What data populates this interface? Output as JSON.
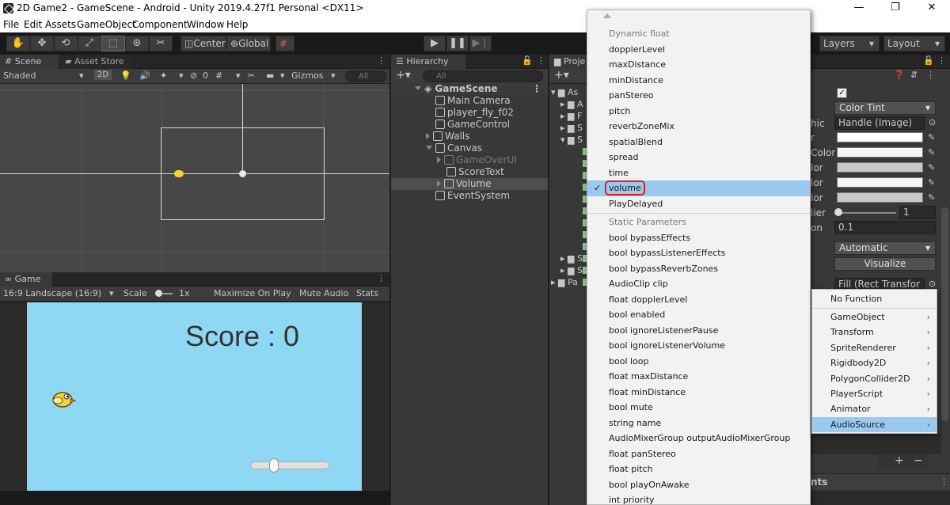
{
  "window": {
    "title": "2D Game2 - GameScene - Android - Unity 2019.4.27f1 Personal <DX11>"
  },
  "menubar": [
    "File",
    "Edit",
    "Assets",
    "GameObject",
    "Component",
    "Window",
    "Help"
  ],
  "toolbar": {
    "pivot": "Center",
    "space": "Global",
    "layers": "Layers",
    "layout": "Layout"
  },
  "scene": {
    "tabs": [
      "Scene",
      "Asset Store"
    ],
    "shading": "Shaded",
    "mode_2d": "2D",
    "effects_count": "0",
    "gizmos": "Gizmos",
    "search_placeholder": "All"
  },
  "game": {
    "tab": "Game",
    "aspect": "16:9 Landscape (16:9)",
    "scale_label": "Scale",
    "scale_value": "1x",
    "maximize": "Maximize On Play",
    "mute": "Mute Audio",
    "stats": "Stats",
    "score_text": "Score : 0",
    "slider_value": 0.3
  },
  "hierarchy": {
    "tab": "Hierarchy",
    "search_placeholder": "All",
    "scene_name": "GameScene",
    "items": [
      {
        "label": "Main Camera"
      },
      {
        "label": "player_fly_f02"
      },
      {
        "label": "GameControl"
      },
      {
        "label": "Walls"
      },
      {
        "label": "Canvas"
      },
      {
        "label": "GameOverUI"
      },
      {
        "label": "ScoreText"
      },
      {
        "label": "Volume"
      },
      {
        "label": "EventSystem"
      }
    ]
  },
  "project": {
    "tab": "Proje",
    "folders": [
      "As",
      "A",
      "F",
      "S",
      "S",
      "S",
      "S",
      "Pa"
    ]
  },
  "inspector": {
    "transition": "Color Tint",
    "target_graphic": "Handle (Image)",
    "label_fragments": [
      "hic",
      "r",
      "Color",
      "lor",
      "lor",
      "lor",
      "lier",
      "on"
    ],
    "color_multiplier": "1",
    "fade_duration": "0.1",
    "navigation": "Automatic",
    "visualize": "Visualize",
    "fill_rect": "Fill (Rect Transfor",
    "events_fragment": "nts"
  },
  "dropdown": {
    "dynamic_header": "Dynamic float",
    "dynamic_items": [
      "dopplerLevel",
      "maxDistance",
      "minDistance",
      "panStereo",
      "pitch",
      "reverbZoneMix",
      "spatialBlend",
      "spread",
      "time",
      "volume",
      "PlayDelayed"
    ],
    "selected": "volume",
    "static_header": "Static Parameters",
    "static_items": [
      "bool bypassEffects",
      "bool bypassListenerEffects",
      "bool bypassReverbZones",
      "AudioClip clip",
      "float dopplerLevel",
      "bool enabled",
      "bool ignoreListenerPause",
      "bool ignoreListenerVolume",
      "bool loop",
      "float maxDistance",
      "float minDistance",
      "bool mute",
      "string name",
      "AudioMixerGroup outputAudioMixerGroup",
      "float panStereo",
      "float pitch",
      "bool playOnAwake",
      "int priority"
    ]
  },
  "submenu": {
    "no_function": "No Function",
    "items": [
      "GameObject",
      "Transform",
      "SpriteRenderer",
      "Rigidbody2D",
      "PolygonCollider2D",
      "PlayerScript",
      "Animator",
      "AudioSource"
    ],
    "selected": "AudioSource"
  },
  "colors": {
    "accent_selection": "#99c9ef",
    "highlight_ring": "#e0201c",
    "game_sky": "#8fd8f4"
  }
}
